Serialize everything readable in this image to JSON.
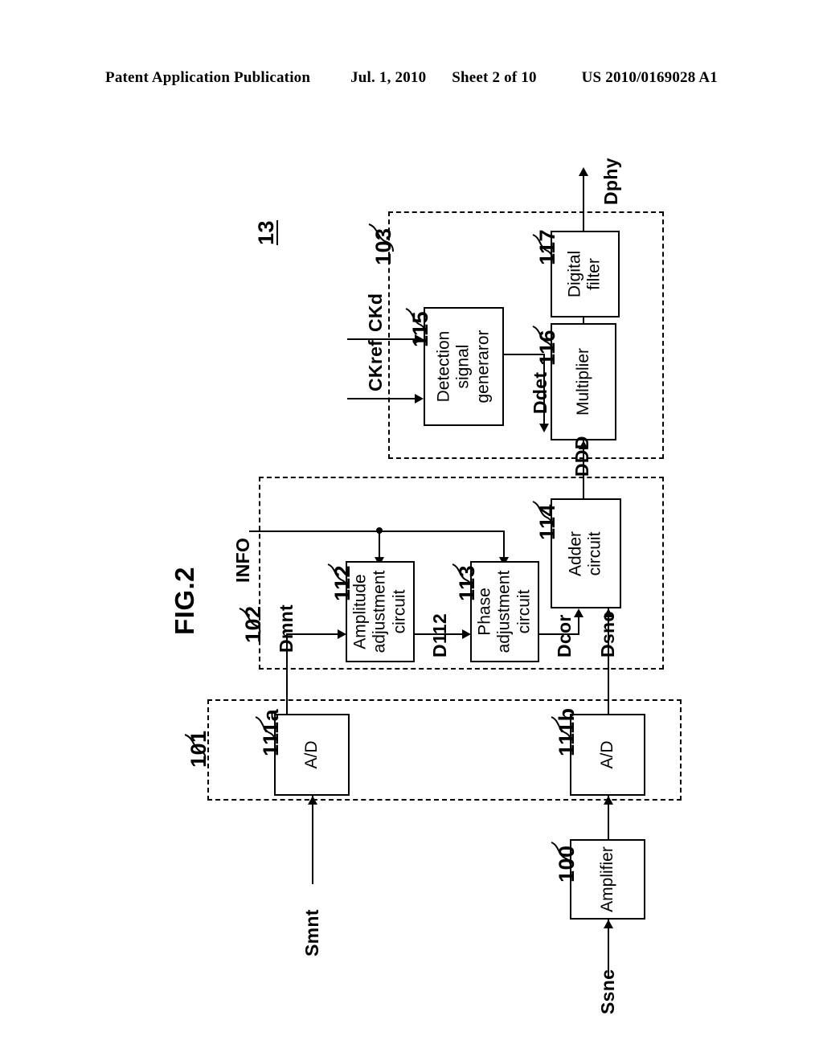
{
  "header": {
    "publication": "Patent Application Publication",
    "date": "Jul. 1, 2010",
    "sheet": "Sheet 2 of 10",
    "number": "US 2010/0169028 A1"
  },
  "figure": {
    "title": "FIG.2",
    "system_ref": "13"
  },
  "groups": [
    {
      "id": "group-101",
      "ref": "101"
    },
    {
      "id": "group-102",
      "ref": "102"
    },
    {
      "id": "group-103",
      "ref": "103"
    }
  ],
  "blocks": [
    {
      "id": "amplifier",
      "ref": "100",
      "label": "Amplifier"
    },
    {
      "id": "ad-mnt",
      "ref": "111a",
      "label": "A/D"
    },
    {
      "id": "ad-snc",
      "ref": "111b",
      "label": "A/D"
    },
    {
      "id": "amplitude-adjust",
      "ref": "112",
      "label": "Amplitude\nadjustment\ncircuit"
    },
    {
      "id": "phase-adjust",
      "ref": "113",
      "label": "Phase\nadjustment\ncircuit"
    },
    {
      "id": "adder",
      "ref": "114",
      "label": "Adder\ncircuit"
    },
    {
      "id": "detection-gen",
      "ref": "115",
      "label": "Detection\nsignal\ngeneraror"
    },
    {
      "id": "multiplier",
      "ref": "116",
      "label": "Multiplier"
    },
    {
      "id": "digital-filter",
      "ref": "117",
      "label": "Digital\nfilter"
    }
  ],
  "signals": {
    "smnt": "Smnt",
    "ssnc": "Ssnc",
    "dmnt": "Dmnt",
    "dsnc": "Dsnc",
    "info": "INFO",
    "d112": "D112",
    "dcor": "Dcor",
    "ddd": "DDD",
    "ckref": "CKref",
    "ckd": "CKd",
    "ddet": "Ddet",
    "dphy": "Dphy"
  },
  "colors": {
    "ink": "#000000",
    "paper": "#ffffff"
  }
}
